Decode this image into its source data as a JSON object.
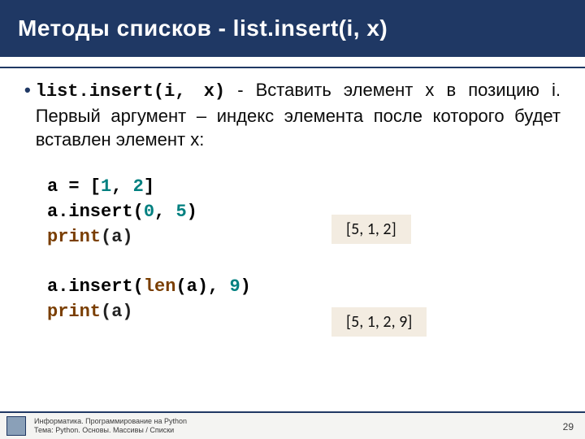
{
  "title": "Методы списков - list.insert(i, x)",
  "bullet": {
    "code": "list.insert(i, x)",
    "rest": " - Вставить элемент x в позицию i. Первый аргумент – индекс элемента после которого будет вставлен элемент x:"
  },
  "code": {
    "l1_a": "a = [",
    "l1_b": "1",
    "l1_c": ", ",
    "l1_d": "2",
    "l1_e": "]",
    "l2_a": "a.insert(",
    "l2_b": "0",
    "l2_c": ", ",
    "l2_d": "5",
    "l2_e": ")",
    "l3_a": "print",
    "l3_b": "(a)",
    "l4_a": "a.insert(",
    "l4_b": "len",
    "l4_c": "(a), ",
    "l4_d": "9",
    "l4_e": ")",
    "l5_a": "print",
    "l5_b": "(a)"
  },
  "outputs": {
    "o1": "[5, 1, 2]",
    "o2": "[5, 1, 2, 9]"
  },
  "footer": {
    "line1": "Информатика. Программирование на Python",
    "line2": "Тема: Python. Основы. Массивы / Списки",
    "page": "29"
  }
}
